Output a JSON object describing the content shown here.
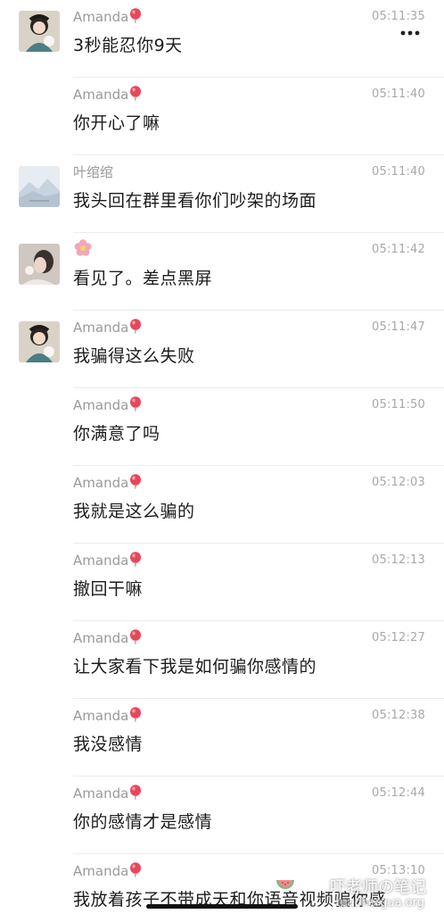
{
  "messages": [
    {
      "sender": "Amanda",
      "badge": "balloon-icon",
      "time": "05:11:35",
      "text": "3秒能忍你9天",
      "avatar": "amanda"
    },
    {
      "sender": "Amanda",
      "badge": "balloon-icon",
      "time": "05:11:40",
      "text": "你开心了嘛",
      "avatar": null
    },
    {
      "sender": "叶绾绾",
      "badge": null,
      "time": "05:11:40",
      "text": "我头回在群里看你们吵架的场面",
      "avatar": "landscape"
    },
    {
      "sender": "",
      "badge": "flower-icon",
      "time": "05:11:42",
      "text": "看见了。差点黑屏",
      "avatar": "portrait"
    },
    {
      "sender": "Amanda",
      "badge": "balloon-icon",
      "time": "05:11:47",
      "text": "我骗得这么失败",
      "avatar": "amanda"
    },
    {
      "sender": "Amanda",
      "badge": "balloon-icon",
      "time": "05:11:50",
      "text": "你满意了吗",
      "avatar": null
    },
    {
      "sender": "Amanda",
      "badge": "balloon-icon",
      "time": "05:12:03",
      "text": "我就是这么骗的",
      "avatar": null
    },
    {
      "sender": "Amanda",
      "badge": "balloon-icon",
      "time": "05:12:13",
      "text": "撤回干嘛",
      "avatar": null
    },
    {
      "sender": "Amanda",
      "badge": "balloon-icon",
      "time": "05:12:27",
      "text": "让大家看下我是如何骗你感情的",
      "avatar": null
    },
    {
      "sender": "Amanda",
      "badge": "balloon-icon",
      "time": "05:12:38",
      "text": "我没感情",
      "avatar": null
    },
    {
      "sender": "Amanda",
      "badge": "balloon-icon",
      "time": "05:12:44",
      "text": "你的感情才是感情",
      "avatar": null
    },
    {
      "sender": "Amanda",
      "badge": "balloon-icon",
      "time": "05:13:10",
      "text": "我放着孩子不带成天和你语音视频骗你感",
      "avatar": null
    }
  ],
  "watermark": {
    "title": "吓老师の笔记",
    "url": "teachergua.org",
    "icon": "watermelon-icon"
  },
  "more_icon": "more-dots-icon",
  "colors": {
    "background": "#ffffff",
    "text": "#1c1c1c",
    "meta": "#9a9a9a",
    "balloon": "#e8475a"
  }
}
